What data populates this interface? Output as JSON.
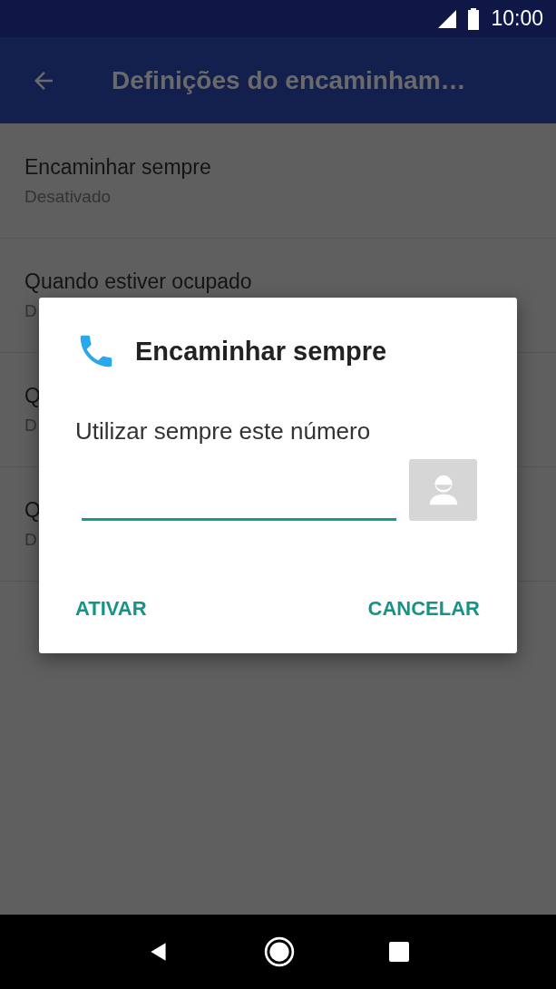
{
  "status_bar": {
    "time": "10:00"
  },
  "toolbar": {
    "title": "Definições do encaminham…"
  },
  "settings": [
    {
      "title": "Encaminhar sempre",
      "subtitle": "Desativado"
    },
    {
      "title": "Quando estiver ocupado",
      "subtitle": "D"
    },
    {
      "title": "Q",
      "subtitle": "D"
    },
    {
      "title": "Q",
      "subtitle": "D"
    }
  ],
  "dialog": {
    "title": "Encaminhar sempre",
    "label": "Utilizar sempre este número",
    "buttons": [
      "ATIVAR",
      "CANCELAR"
    ]
  }
}
